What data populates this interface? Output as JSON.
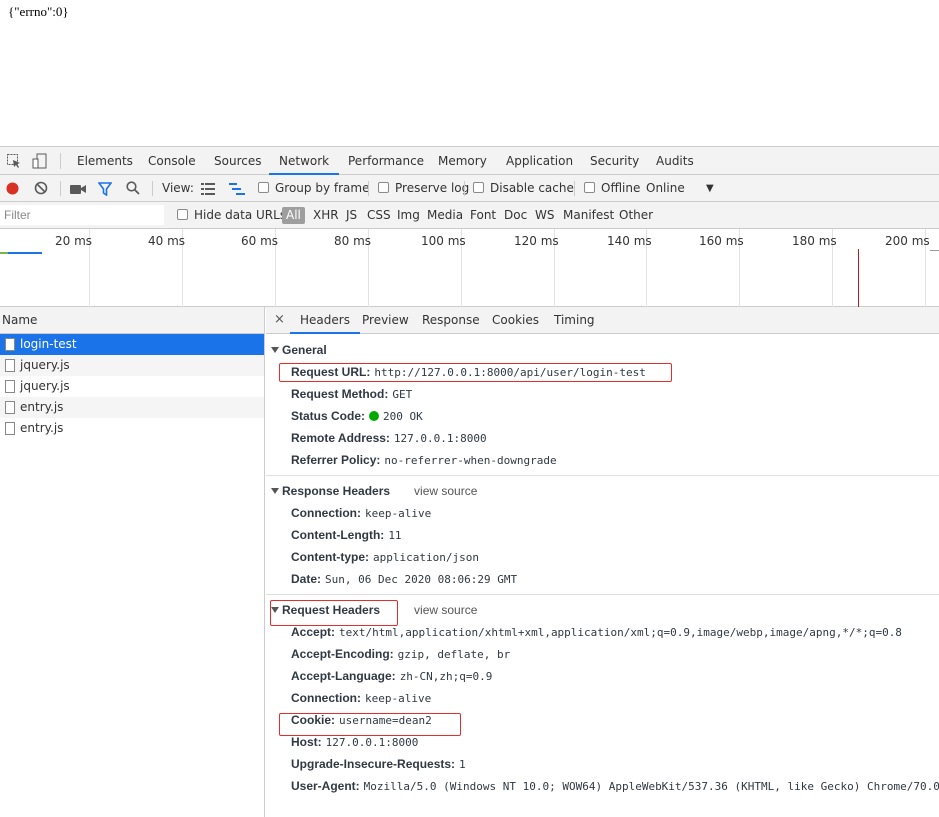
{
  "page_body": "{\"errno\":0}",
  "devtools": {
    "tabs": [
      "Elements",
      "Console",
      "Sources",
      "Network",
      "Performance",
      "Memory",
      "Application",
      "Security",
      "Audits"
    ],
    "active_tab": "Network"
  },
  "toolbar": {
    "view_label": "View:",
    "group_by_frame": "Group by frame",
    "preserve_log": "Preserve log",
    "disable_cache": "Disable cache",
    "offline": "Offline",
    "throttle": "Online"
  },
  "filterbar": {
    "placeholder": "Filter",
    "hide_data_urls": "Hide data URLs",
    "types": [
      "All",
      "XHR",
      "JS",
      "CSS",
      "Img",
      "Media",
      "Font",
      "Doc",
      "WS",
      "Manifest",
      "Other"
    ]
  },
  "timeline": {
    "ticks": [
      "20 ms",
      "40 ms",
      "60 ms",
      "80 ms",
      "100 ms",
      "120 ms",
      "140 ms",
      "160 ms",
      "180 ms",
      "200 ms"
    ]
  },
  "requests": {
    "header": "Name",
    "items": [
      "login-test",
      "jquery.js",
      "jquery.js",
      "entry.js",
      "entry.js"
    ],
    "selected": "login-test"
  },
  "details": {
    "close": "×",
    "tabs": [
      "Headers",
      "Preview",
      "Response",
      "Cookies",
      "Timing"
    ],
    "active_tab": "Headers",
    "general": {
      "title": "General",
      "request_url_key": "Request URL:",
      "request_url": "http://127.0.0.1:8000/api/user/login-test",
      "method_key": "Request Method:",
      "method": "GET",
      "status_key": "Status Code:",
      "status": "200 OK",
      "remote_key": "Remote Address:",
      "remote": "127.0.0.1:8000",
      "referrer_key": "Referrer Policy:",
      "referrer": "no-referrer-when-downgrade"
    },
    "response_headers": {
      "title": "Response Headers",
      "view_source": "view source",
      "rows": [
        {
          "k": "Connection:",
          "v": "keep-alive"
        },
        {
          "k": "Content-Length:",
          "v": "11"
        },
        {
          "k": "Content-type:",
          "v": "application/json"
        },
        {
          "k": "Date:",
          "v": "Sun, 06 Dec 2020 08:06:29 GMT"
        }
      ]
    },
    "request_headers": {
      "title": "Request Headers",
      "view_source": "view source",
      "rows": [
        {
          "k": "Accept:",
          "v": "text/html,application/xhtml+xml,application/xml;q=0.9,image/webp,image/apng,*/*;q=0.8"
        },
        {
          "k": "Accept-Encoding:",
          "v": "gzip, deflate, br"
        },
        {
          "k": "Accept-Language:",
          "v": "zh-CN,zh;q=0.9"
        },
        {
          "k": "Connection:",
          "v": "keep-alive"
        },
        {
          "k": "Cookie:",
          "v": "username=dean2"
        },
        {
          "k": "Host:",
          "v": "127.0.0.1:8000"
        },
        {
          "k": "Upgrade-Insecure-Requests:",
          "v": "1"
        },
        {
          "k": "User-Agent:",
          "v": "Mozilla/5.0 (Windows NT 10.0; WOW64) AppleWebKit/537.36 (KHTML, like Gecko) Chrome/70.0"
        }
      ]
    }
  },
  "colors": {
    "accent": "#1a73e8",
    "highlight_box": "#e52d2d",
    "record": "#d93025",
    "status_ok": "#00aa00"
  }
}
